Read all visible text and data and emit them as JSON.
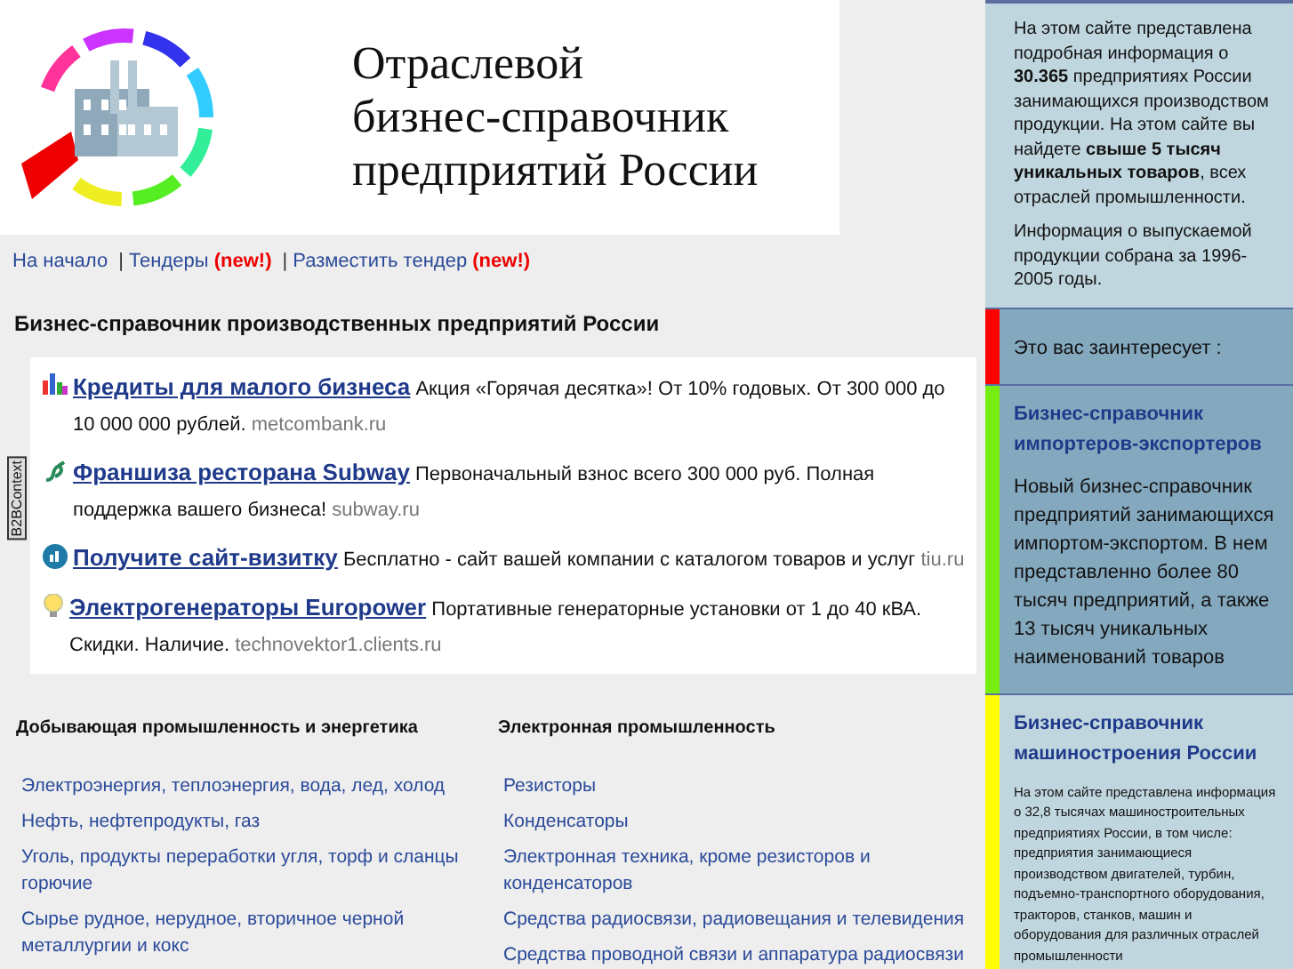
{
  "logo": {
    "title": "Отраслевой\nбизнес-справочник\nпредприятий России"
  },
  "nav": [
    {
      "label": "На начало"
    },
    {
      "separator": "|",
      "label": "Тендеры",
      "badge": "(new!)"
    },
    {
      "separator": "|",
      "label": "Разместить тендер",
      "badge": "(new!)"
    }
  ],
  "heading": "Бизнес-справочник производственных предприятий России",
  "ads_label": "B2BContext",
  "ads": [
    {
      "title": "Кредиты для малого бизнеса",
      "text": "Акция «Горячая десятка»! От 10% годовых. От 300 000 до 10 000 000 рублей.",
      "domain": "metcombank.ru"
    },
    {
      "title": "Франшиза ресторана Subway",
      "text": "Первоначальный взнос всего 300 000 руб. Полная поддержка вашего бизнеса!",
      "domain": "subway.ru"
    },
    {
      "title": "Получите сайт-визитку",
      "text": "Бесплатно - сайт вашей компании с каталогом товаров и услуг",
      "domain": "tiu.ru"
    },
    {
      "title": "Электрогенераторы Europower",
      "text": "Портативные генераторные установки от 1 до 40 кВА. Скидки. Наличие.",
      "domain": "technovektor1.clients.ru"
    }
  ],
  "categories": [
    {
      "title": "Добывающая промышленность и энергетика",
      "items": [
        "Электроэнергия, теплоэнергия, вода, лед, холод",
        "Нефть, нефтепродукты, газ",
        "Уголь, продукты переработки угля, торф и сланцы горючие",
        "Сырье рудное, нерудное, вторичное черной металлургии и кокс"
      ]
    },
    {
      "title": "Электронная промышленность",
      "items": [
        "Резисторы",
        "Конденсаторы",
        "Электронная техника, кроме резисторов и конденсаторов",
        "Средства радиосвязи, радиовещания и телевидения",
        "Средства проводной связи и аппаратура радиосвязи"
      ]
    }
  ],
  "sidebar": {
    "intro": [
      "На этом сайте представлена подробная информация о **30.365** предприятиях России занимающихся производством продукции. На этом сайте вы найдете **свыше 5 тысяч уникальных товаров**, всех отраслей промышленности.",
      "Информация о выпускаемой продукции собрана за 1996-2005 годы."
    ],
    "blocks": [
      {
        "kind": "note",
        "color": "#ff0000",
        "text": "Это вас заинтересует :"
      },
      {
        "kind": "promo",
        "color": "#77ee11",
        "title": "Бизнес-справочник импортеров-экспортеров",
        "text": "Новый бизнес-справочник предприятий занимающихся импортом-экспортом. В нем представленно более 80 тысяч предприятий, а также 13 тысяч уникальных наименований товаров"
      },
      {
        "kind": "promo-small",
        "color": "#ffff00",
        "title": "Бизнес-справочник машиностроения России",
        "text": "На этом сайте представлена информация о 32,8 тысячах машиностроительных предприятиях России, в том числе: предприятия занимающиеся производством двигателей, турбин, подъемно-транспортного оборудования, тракторов, станков, машин и оборудования для различных отраслей промышленности"
      }
    ]
  }
}
